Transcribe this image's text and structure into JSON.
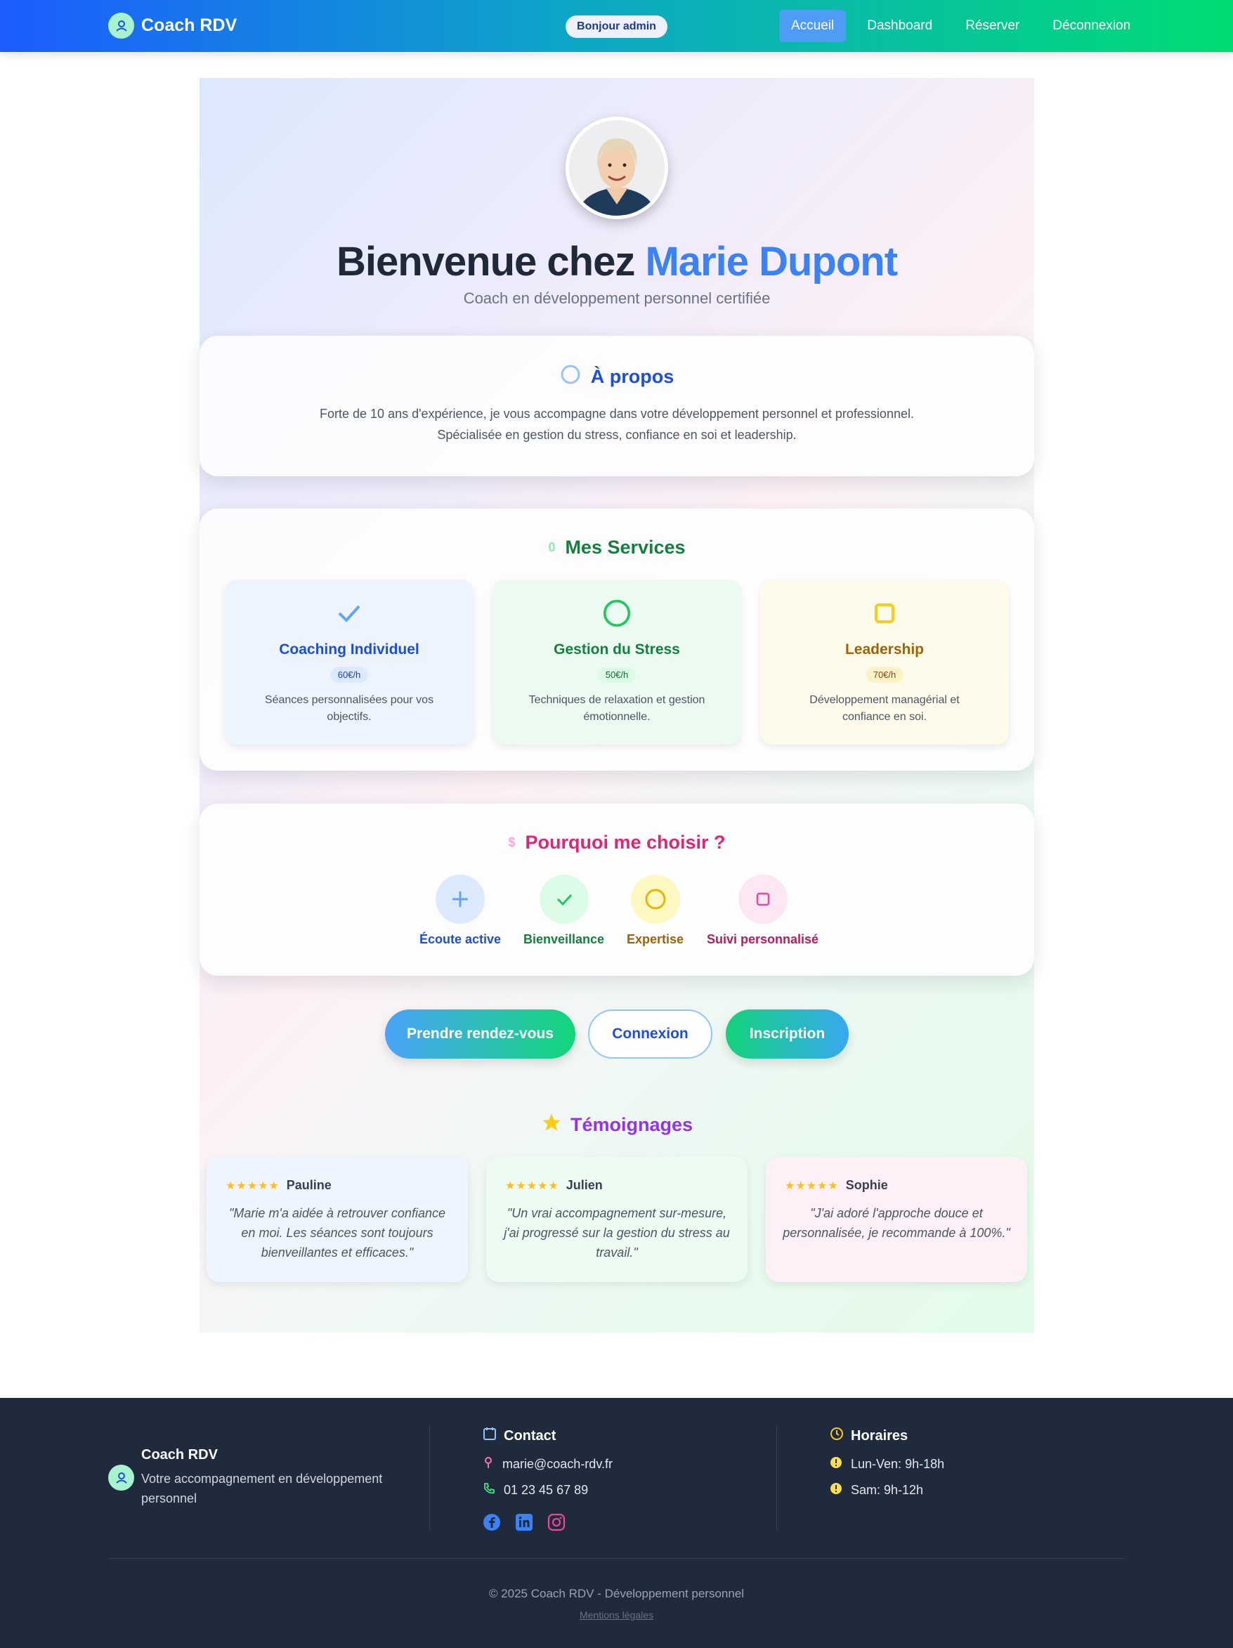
{
  "navbar": {
    "brand": "Coach RDV",
    "greeting": "Bonjour admin",
    "links": [
      "Accueil",
      "Dashboard",
      "Réserver",
      "Déconnexion"
    ],
    "active_link": "Accueil"
  },
  "hero": {
    "title_prefix": "Bienvenue chez ",
    "title_name": "Marie Dupont",
    "subtitle": "Coach en développement personnel certifiée"
  },
  "about": {
    "title": "À propos",
    "text_line1": "Forte de 10 ans d'expérience, je vous accompagne dans votre développement personnel et professionnel.",
    "text_line2": "Spécialisée en gestion du stress, confiance en soi et leadership."
  },
  "services": {
    "icon_char": "0",
    "title": "Mes Services",
    "items": [
      {
        "title": "Coaching Individuel",
        "price": "60€/h",
        "desc": "Séances personnalisées pour vos objectifs.",
        "icon": "check-icon"
      },
      {
        "title": "Gestion du Stress",
        "price": "50€/h",
        "desc": "Techniques de relaxation et gestion émotionnelle.",
        "icon": "circle-icon"
      },
      {
        "title": "Leadership",
        "price": "70€/h",
        "desc": "Développement managérial et confiance en soi.",
        "icon": "square-icon"
      }
    ]
  },
  "why": {
    "icon_char": "$",
    "title": "Pourquoi me choisir ?",
    "items": [
      {
        "label": "Écoute active",
        "icon": "plus-icon"
      },
      {
        "label": "Bienveillance",
        "icon": "check-icon"
      },
      {
        "label": "Expertise",
        "icon": "circle-icon"
      },
      {
        "label": "Suivi personnalisé",
        "icon": "square-icon"
      }
    ]
  },
  "actions": {
    "book": "Prendre rendez-vous",
    "login": "Connexion",
    "signup": "Inscription"
  },
  "testimonials": {
    "title": "Témoignages",
    "items": [
      {
        "stars": "★★★★★",
        "name": "Pauline",
        "quote": "\"Marie m'a aidée à retrouver confiance en moi. Les séances sont toujours bienveillantes et efficaces.\""
      },
      {
        "stars": "★★★★★",
        "name": "Julien",
        "quote": "\"Un vrai accompagnement sur-mesure, j'ai progressé sur la gestion du stress au travail.\""
      },
      {
        "stars": "★★★★★",
        "name": "Sophie",
        "quote": "\"J'ai adoré l'approche douce et personnalisée, je recommande à 100%.\""
      }
    ]
  },
  "footer": {
    "brand": "Coach RDV",
    "tagline": "Votre accompagnement en développement personnel",
    "contact_title": "Contact",
    "email": "marie@coach-rdv.fr",
    "phone": "01 23 45 67 89",
    "hours_title": "Horaires",
    "hours": [
      "Lun-Ven: 9h-18h",
      "Sam: 9h-12h"
    ],
    "copyright": "© 2025 Coach RDV - Développement personnel",
    "legal": "Mentions légales"
  },
  "colors": {
    "brand_blue": "#3b82f6",
    "brand_green": "#12d67a",
    "footer_bg": "#1f2a3c"
  }
}
